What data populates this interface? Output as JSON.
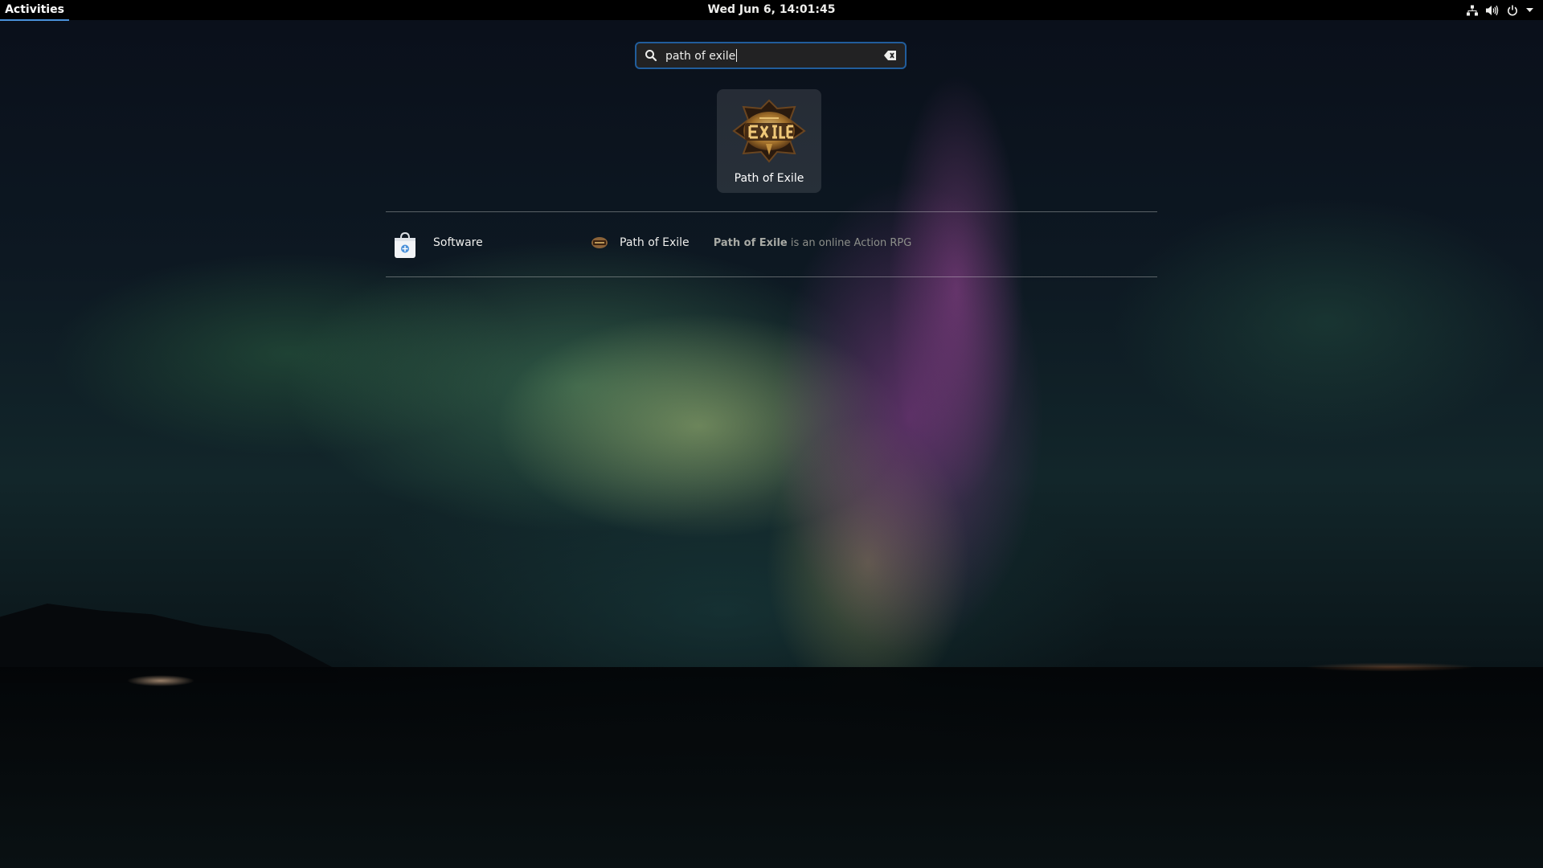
{
  "topbar": {
    "activities": "Activities",
    "clock": "Wed Jun  6, 14:01:45",
    "tray_icons": [
      "network-icon",
      "volume-icon",
      "power-icon",
      "dropdown-arrow-icon"
    ]
  },
  "search": {
    "value": "path of exile",
    "icon": "search-icon",
    "clear_icon": "edit-clear-icon"
  },
  "app_results": [
    {
      "label": "Path of Exile",
      "icon": "path-of-exile-logo"
    }
  ],
  "provider": {
    "name": "Software",
    "icon": "software-bag-icon",
    "result": {
      "title": "Path of Exile",
      "desc_highlight": "Path of Exile",
      "desc_rest": " is an online Action RPG"
    }
  },
  "colors": {
    "accent": "#215d9c",
    "activities_underline": "#4a90d9",
    "topbar": "#000000",
    "dim_text": "#8d8f8a"
  }
}
